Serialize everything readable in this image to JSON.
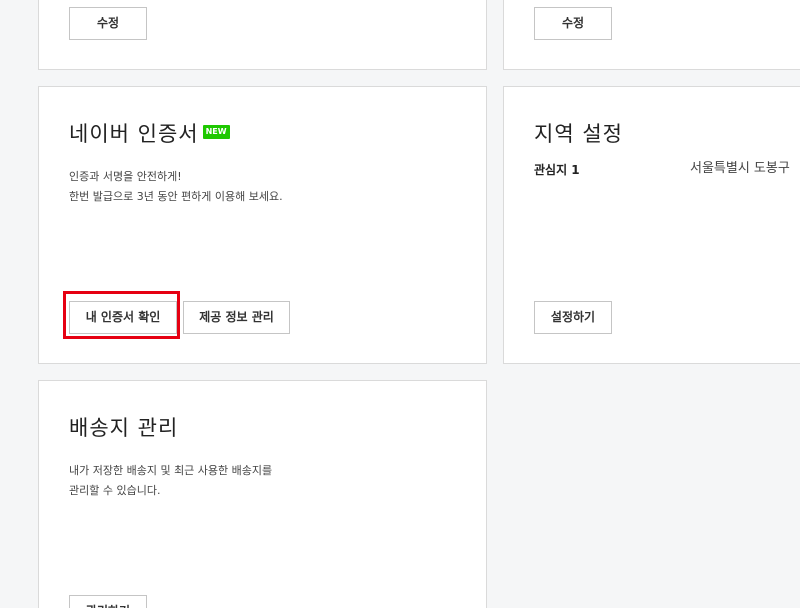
{
  "top_left": {
    "edit_label": "수정"
  },
  "top_right": {
    "edit_label": "수정"
  },
  "certificate": {
    "title": "네이버 인증서",
    "badge": "NEW",
    "desc_line1": "인증과 서명을 안전하게!",
    "desc_line2": "한번 발급으로 3년 동안 편하게 이용해 보세요.",
    "my_cert_label": "내 인증서 확인",
    "provided_info_label": "제공 정보 관리"
  },
  "region": {
    "title": "지역 설정",
    "interest_label": "관심지 1",
    "interest_value": "서울특별시 도봉구",
    "settings_label": "설정하기"
  },
  "shipping": {
    "title": "배송지 관리",
    "desc_line1": "내가 저장한 배송지 및 최근 사용한 배송지를",
    "desc_line2": "관리할 수 있습니다.",
    "manage_label": "관리하기"
  },
  "colors": {
    "badge_green": "#1ec800",
    "highlight_red": "#e60012",
    "page_bg": "#f5f6f7"
  }
}
